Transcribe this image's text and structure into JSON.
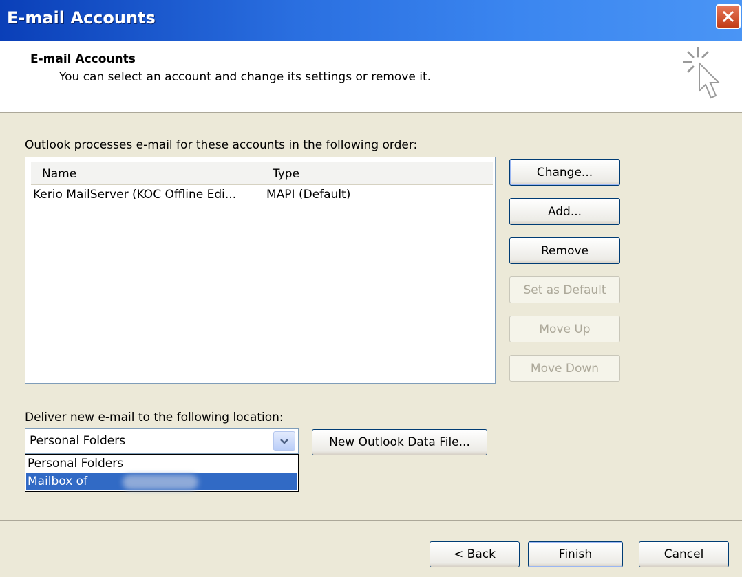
{
  "window": {
    "title": "E-mail Accounts"
  },
  "header": {
    "title": "E-mail Accounts",
    "subtitle": "You can select an account and change its settings or remove it."
  },
  "accounts": {
    "label": "Outlook processes e-mail for these accounts in the following order:",
    "columns": [
      "Name",
      "Type"
    ],
    "rows": [
      {
        "name": "Kerio MailServer (KOC Offline Edi...",
        "type": "MAPI (Default)"
      }
    ]
  },
  "side_buttons": {
    "change": "Change...",
    "add": "Add...",
    "remove": "Remove",
    "set_default": "Set as Default",
    "move_up": "Move Up",
    "move_down": "Move Down"
  },
  "delivery": {
    "label": "Deliver new e-mail to the following location:",
    "selected": "Personal Folders",
    "options": [
      "Personal Folders",
      "Mailbox of"
    ],
    "highlighted_option": "Mailbox of",
    "new_data_file_label": "New Outlook Data File..."
  },
  "footer": {
    "back": "< Back",
    "finish": "Finish",
    "cancel": "Cancel"
  },
  "colors": {
    "titlebar": "#2a6fe0",
    "close": "#c23c16",
    "face": "#ece9d8",
    "selection": "#316ac5"
  },
  "icons": [
    "close-icon",
    "wizard-cursor-icon",
    "dropdown-arrow-icon"
  ]
}
